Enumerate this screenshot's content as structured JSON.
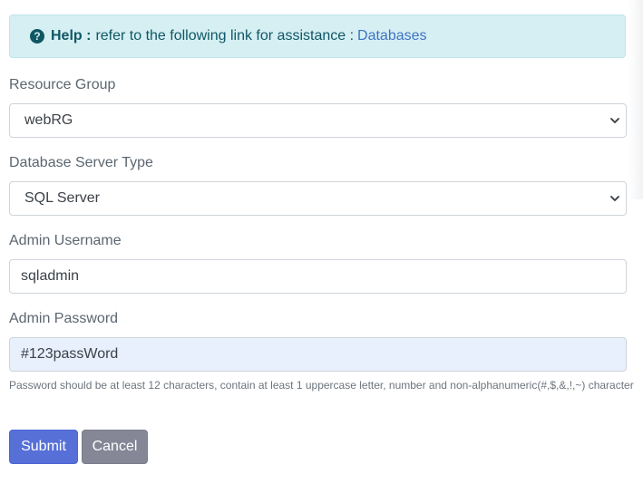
{
  "help": {
    "strong": "Help :",
    "text": "refer to the following link for assistance :",
    "link": "Databases",
    "icon": "question-circle-icon"
  },
  "form": {
    "resource_group": {
      "label": "Resource Group",
      "selected": "webRG"
    },
    "server_type": {
      "label": "Database Server Type",
      "selected": "SQL Server"
    },
    "admin_username": {
      "label": "Admin Username",
      "value": "sqladmin"
    },
    "admin_password": {
      "label": "Admin Password",
      "value": "#123passWord",
      "hint": "Password should be at least 12 characters, contain at least 1 uppercase letter, number and non-alphanumeric(#,$,&,!,~) character"
    }
  },
  "buttons": {
    "submit": "Submit",
    "cancel": "Cancel"
  },
  "colors": {
    "alert_bg": "#d6eff3",
    "alert_text": "#0f5764",
    "link": "#3f73c4",
    "submit_bg": "#5670d8",
    "cancel_bg": "#858796",
    "autofill_bg": "#e8f0fe"
  }
}
